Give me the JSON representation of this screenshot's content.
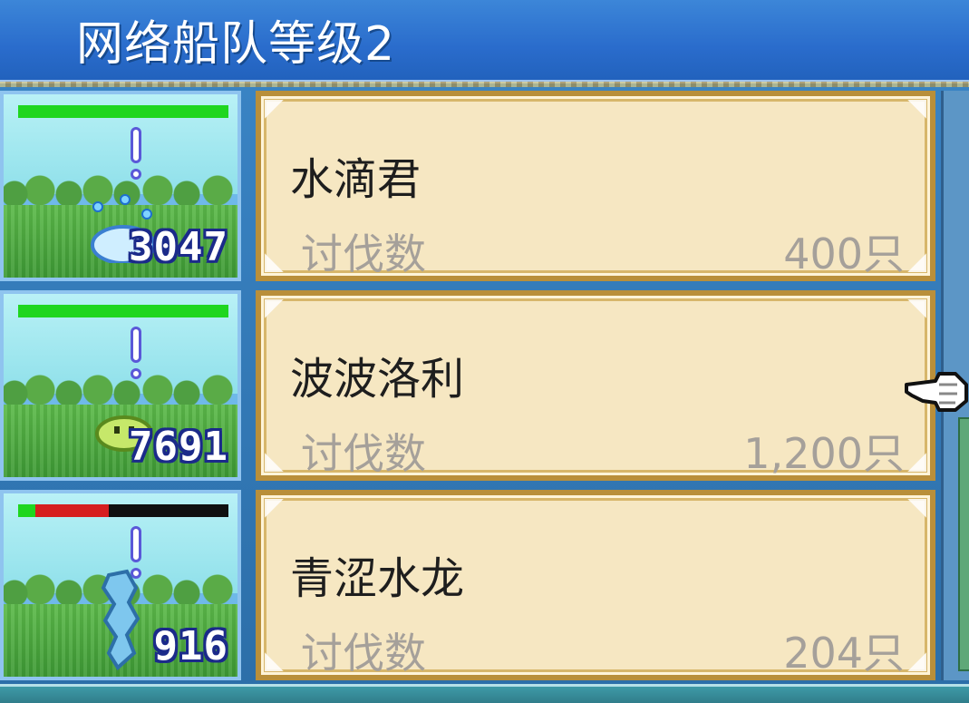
{
  "header": {
    "title": "网络船队等级2"
  },
  "entries": [
    {
      "name": "水滴君",
      "label": "讨伐数",
      "count": "400只",
      "power": "3047",
      "hp_green": 1.0,
      "hp_red": 0.0,
      "monster_icon": "water-drop-slime-icon"
    },
    {
      "name": "波波洛利",
      "label": "讨伐数",
      "count": "1,200只",
      "power": "7691",
      "hp_green": 1.0,
      "hp_red": 0.0,
      "monster_icon": "green-slime-icon"
    },
    {
      "name": "青涩水龙",
      "label": "讨伐数",
      "count": "204只",
      "power": "916",
      "hp_green": 0.08,
      "hp_red": 0.35,
      "monster_icon": "water-dragon-icon"
    }
  ],
  "colors": {
    "header_bg": "#2a6ccc",
    "card_bg": "#f6e7c2",
    "card_border": "#b98f3a",
    "hp_green": "#1fd61f",
    "hp_red": "#d61f1f",
    "label_gray": "#a5a09a"
  },
  "cursor_icon": "pointing-hand-cursor-icon"
}
